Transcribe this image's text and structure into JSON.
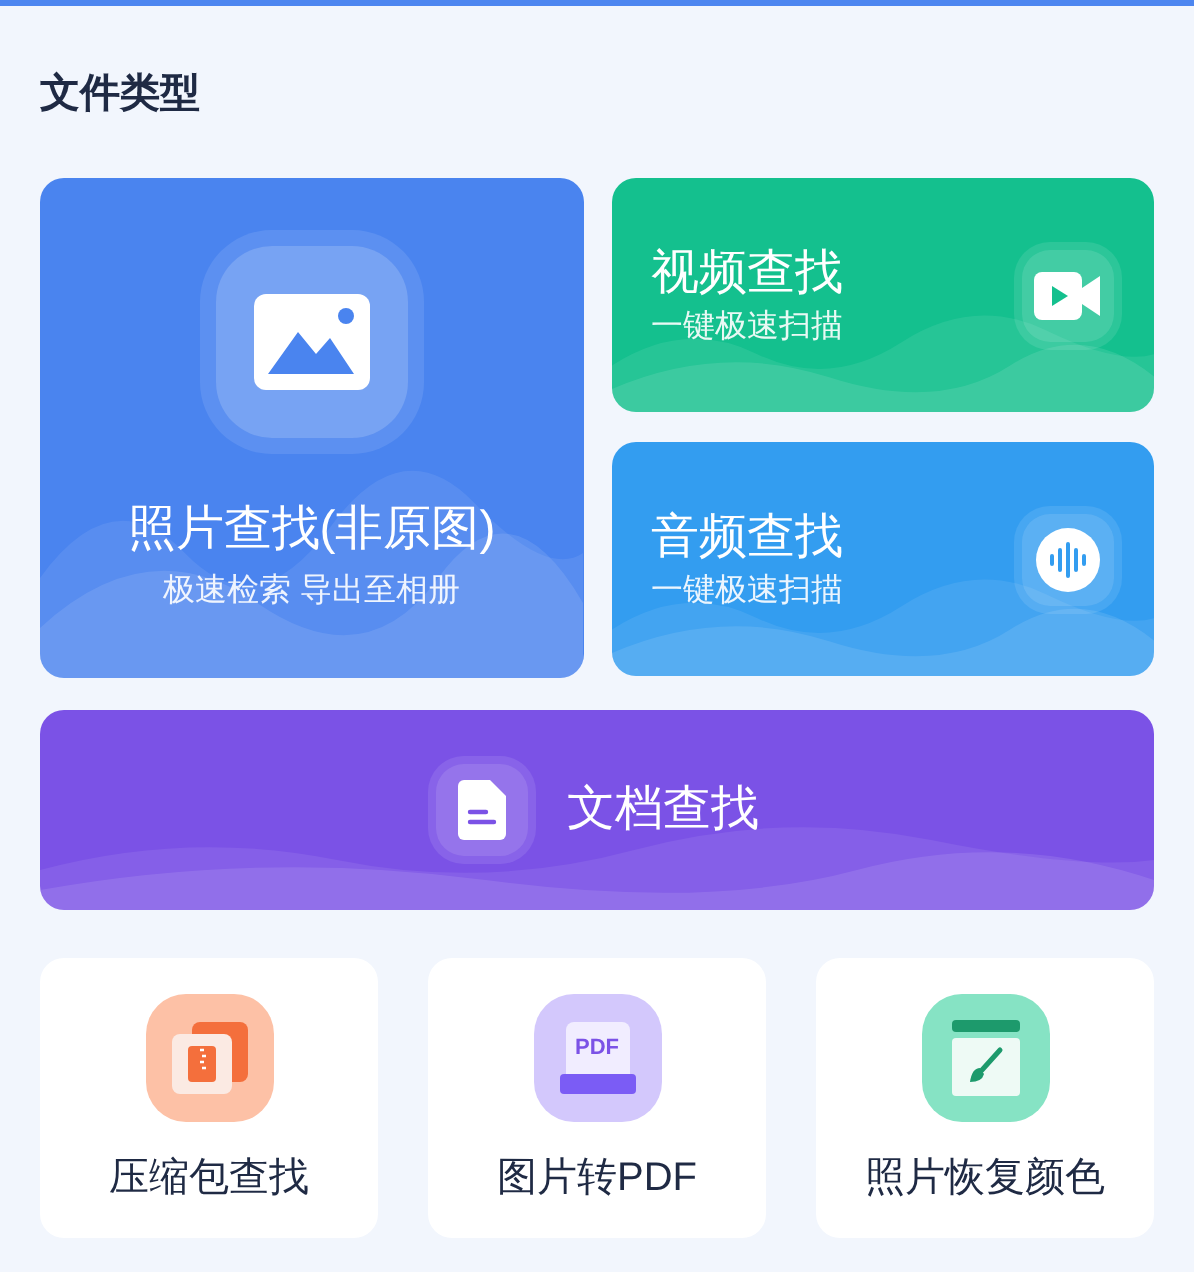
{
  "section_title": "文件类型",
  "cards": [
    {
      "kind": "photo",
      "title": "照片查找(非原图)",
      "subtitle": "极速检索 导出至相册"
    },
    {
      "kind": "video",
      "title": "视频查找",
      "subtitle": "一键极速扫描"
    },
    {
      "kind": "audio",
      "title": "音频查找",
      "subtitle": "一键极速扫描"
    }
  ],
  "document_card": {
    "title": "文档查找"
  },
  "tools": [
    {
      "kind": "archive",
      "label": "压缩包查找"
    },
    {
      "kind": "pdf",
      "label": "图片转PDF",
      "icon_text": "PDF"
    },
    {
      "kind": "recolor",
      "label": "照片恢复颜色"
    }
  ]
}
